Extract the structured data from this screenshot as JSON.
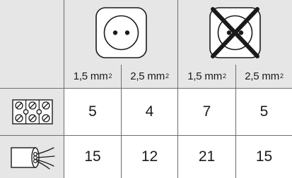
{
  "table": {
    "header": {
      "groups": [
        {
          "name": "socket",
          "icon": "socket-icon"
        },
        {
          "name": "socket-crossed",
          "icon": "socket-crossed-icon"
        }
      ],
      "subheaders": [
        {
          "value": "1,5 mm",
          "sup": "2"
        },
        {
          "value": "2,5 mm",
          "sup": "2"
        },
        {
          "value": "1,5 mm",
          "sup": "2"
        },
        {
          "value": "2,5 mm",
          "sup": "2"
        }
      ]
    },
    "rows": [
      {
        "icon": "terminal-block-icon",
        "values": [
          "5",
          "4",
          "7",
          "5"
        ]
      },
      {
        "icon": "cable-icon",
        "values": [
          "15",
          "12",
          "21",
          "15"
        ]
      }
    ]
  },
  "colors": {
    "shade": "#e6e6e6",
    "line": "#6e6e6e",
    "cross": "#1a1a1a"
  }
}
